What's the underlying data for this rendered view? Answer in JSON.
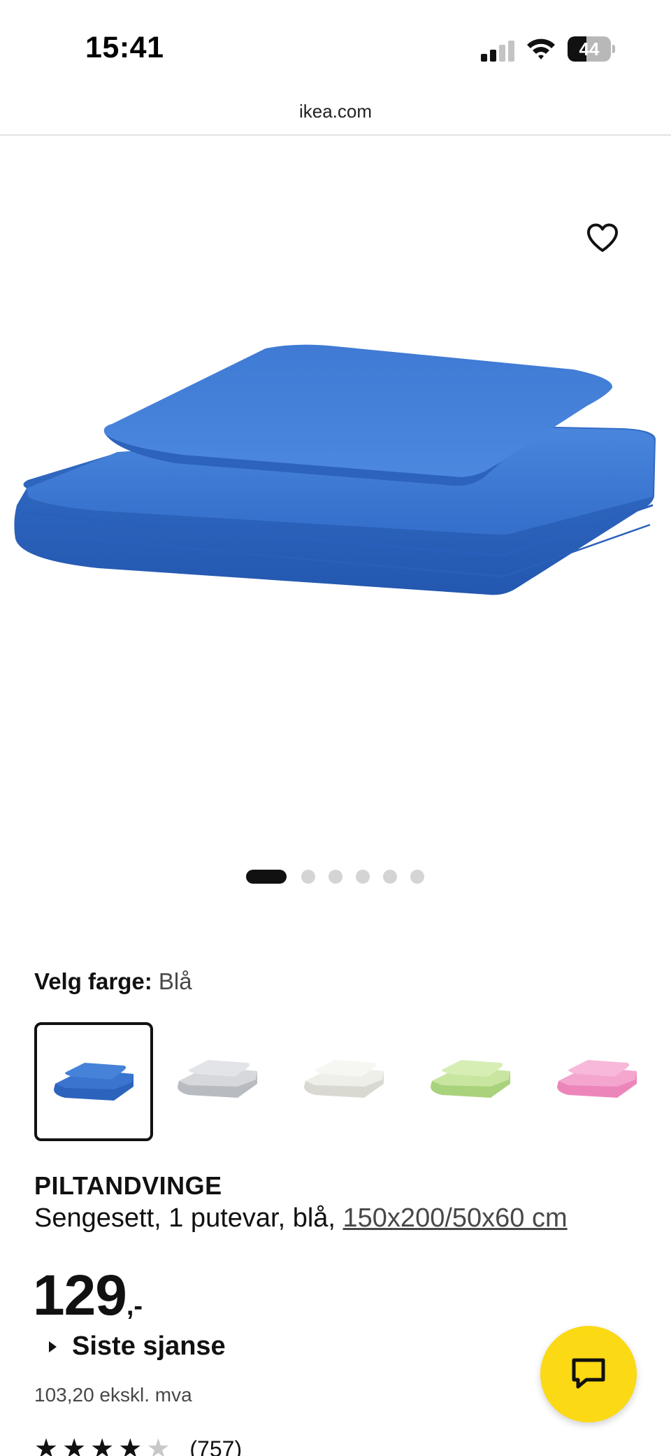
{
  "status_bar": {
    "time": "15:41",
    "battery_level": "44",
    "battery_fraction": 0.44
  },
  "browser": {
    "url": "ikea.com"
  },
  "gallery": {
    "image_count": 6,
    "active_index": 0,
    "favorite_icon": "heart-outline-icon"
  },
  "color_picker": {
    "label": "Velg farge:",
    "selected_value": "Blå",
    "swatches": [
      {
        "color": "#3a74cf",
        "selected": true
      },
      {
        "color": "#d6d8dc",
        "selected": false
      },
      {
        "color": "#efefea",
        "selected": false
      },
      {
        "color": "#c8e6a0",
        "selected": false
      },
      {
        "color": "#f4a6cf",
        "selected": false
      }
    ]
  },
  "product": {
    "name": "PILTANDVINGE",
    "description": "Sengesett, 1 putevar, blå, ",
    "size": "150x200/50x60 cm",
    "price_integer": "129",
    "price_suffix": ",-",
    "last_chance_label": "Siste sjanse",
    "price_excl_vat": "103,20 ekskl. mva",
    "rating": 4.5,
    "review_count": "(757)"
  },
  "chat_button": {
    "icon": "chat-bubble-icon",
    "color": "#fbd914"
  }
}
